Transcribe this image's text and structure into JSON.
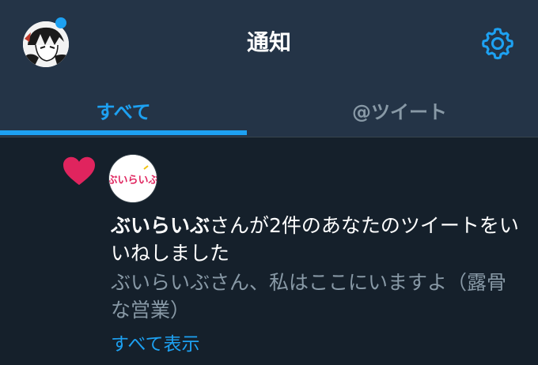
{
  "header": {
    "title": "通知"
  },
  "tabs": [
    {
      "label": "すべて",
      "active": true
    },
    {
      "label": "@ツイート",
      "active": false
    }
  ],
  "notification": {
    "type": "like",
    "actor_name": "ぶいらいぶ",
    "action_text": "さんが2件のあなたのツイートをいいねしました",
    "tweet_preview": "ぶいらいぶさん、私はここにいますよ（露骨な営業）",
    "show_all_label": "すべて表示",
    "actor_logo_text": "ぶいらいぶ"
  },
  "colors": {
    "accent": "#1da1f2",
    "like": "#e0245e",
    "background": "#15202b",
    "header": "#243447",
    "muted": "#8899a6"
  }
}
